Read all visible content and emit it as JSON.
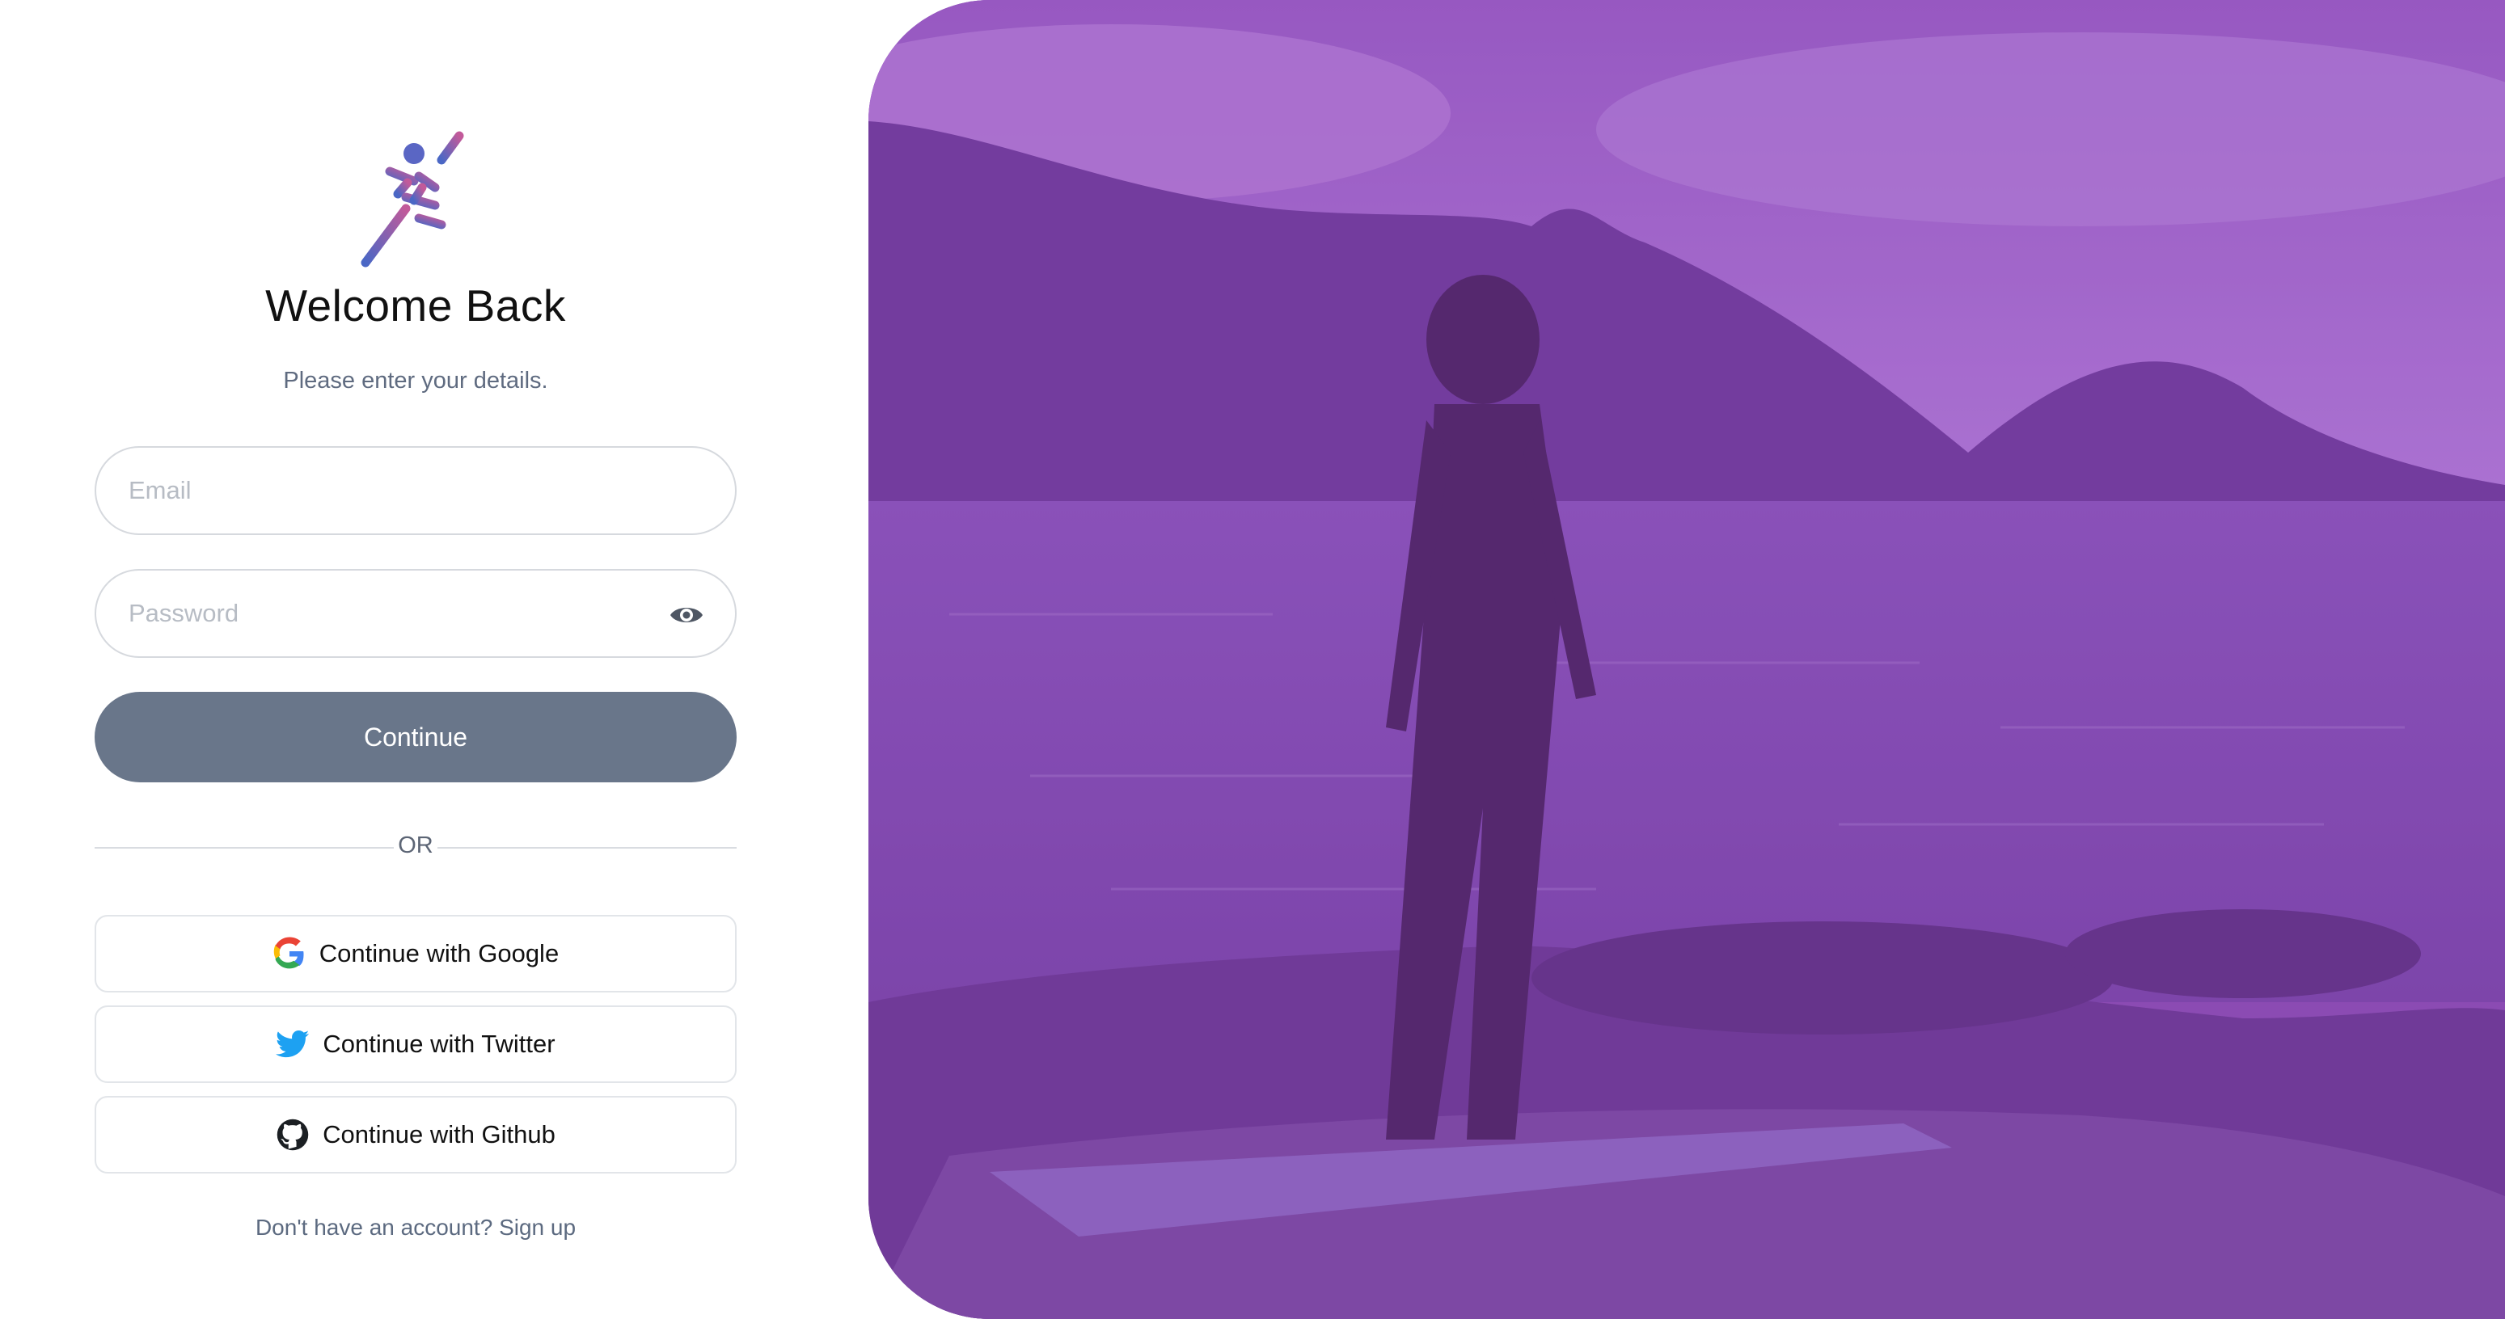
{
  "login": {
    "title": "Welcome Back",
    "subtitle": "Please enter your details.",
    "email_placeholder": "Email",
    "password_placeholder": "Password",
    "continue_label": "Continue",
    "divider_text": "OR",
    "social": {
      "google": "Continue with Google",
      "twitter": "Continue with Twitter",
      "github": "Continue with Github"
    },
    "signup_text": "Don't have an account? Sign up"
  },
  "colors": {
    "primary_button": "#69768a",
    "hero_overlay": "#8b4fb2"
  },
  "icons": {
    "logo": "runner-logo-icon",
    "password_toggle": "eye-icon",
    "google": "google-icon",
    "twitter": "twitter-icon",
    "github": "github-icon"
  }
}
